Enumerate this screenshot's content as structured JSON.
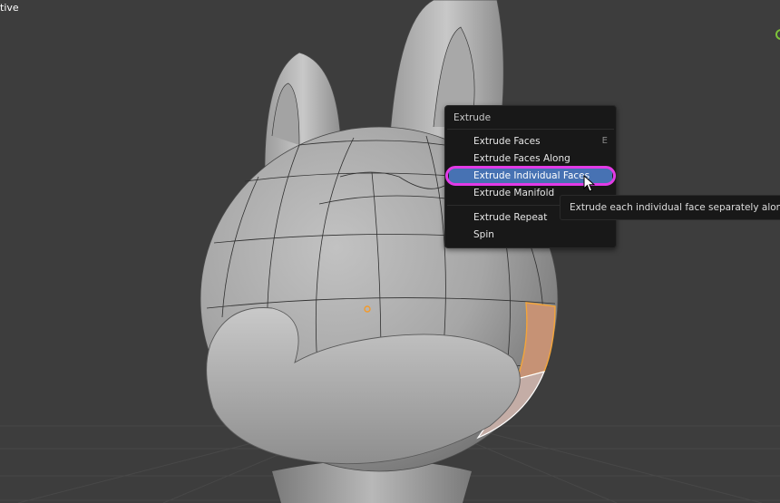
{
  "viewport": {
    "corner_label": "tive",
    "background": "#3d3d3d"
  },
  "extrude_menu": {
    "title": "Extrude",
    "items": [
      {
        "label": "Extrude Faces",
        "shortcut": "E",
        "active": false
      },
      {
        "label": "Extrude Faces Along Normals",
        "shortcut": "",
        "active": false
      },
      {
        "label": "Extrude Individual Faces",
        "shortcut": "",
        "active": true
      },
      {
        "label": "Extrude Manifold",
        "shortcut": "",
        "active": false
      },
      {
        "label": "Extrude Repeat",
        "shortcut": "",
        "active": false
      },
      {
        "label": "Spin",
        "shortcut": "",
        "active": false
      }
    ]
  },
  "tooltip": {
    "text": "Extrude each individual face separately along local normals"
  },
  "colors": {
    "menu_bg": "#181818",
    "active_item": "#4772b3",
    "highlight_ring": "#e23be6",
    "selected_face": "#d69a6e",
    "origin_dot": "#f39a2b"
  }
}
